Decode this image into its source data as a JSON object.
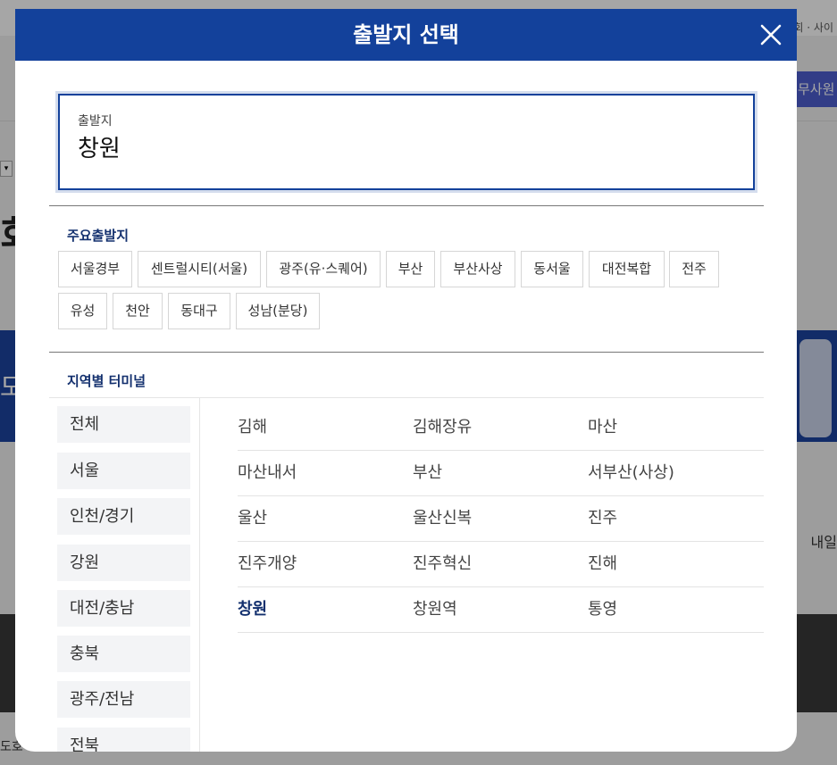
{
  "background": {
    "top_links": "회 · 사이",
    "member_button": "무사원",
    "big_char": "회",
    "banner_char": "도",
    "tomorrow": "내일",
    "bottom_text": "도호"
  },
  "modal": {
    "title": "출발지 선택",
    "close_icon": "close-icon"
  },
  "origin": {
    "label": "출발지",
    "value": "창원"
  },
  "major": {
    "title": "주요출발지",
    "items": [
      "서울경부",
      "센트럴시티(서울)",
      "광주(유·스퀘어)",
      "부산",
      "부산사상",
      "동서울",
      "대전복합",
      "전주",
      "유성",
      "천안",
      "동대구",
      "성남(분당)"
    ]
  },
  "regional": {
    "title": "지역별 터미널",
    "regions": [
      "전체",
      "서울",
      "인천/경기",
      "강원",
      "대전/충남",
      "충북",
      "광주/전남",
      "전북"
    ],
    "terminals": [
      [
        "김해",
        "김해장유",
        "마산"
      ],
      [
        "마산내서",
        "부산",
        "서부산(사상)"
      ],
      [
        "울산",
        "울산신복",
        "진주"
      ],
      [
        "진주개양",
        "진주혁신",
        "진해"
      ],
      [
        "창원",
        "창원역",
        "통영"
      ]
    ],
    "selected_terminal": "창원"
  },
  "colors": {
    "header": "#13419b",
    "selected_text": "#13306e"
  }
}
